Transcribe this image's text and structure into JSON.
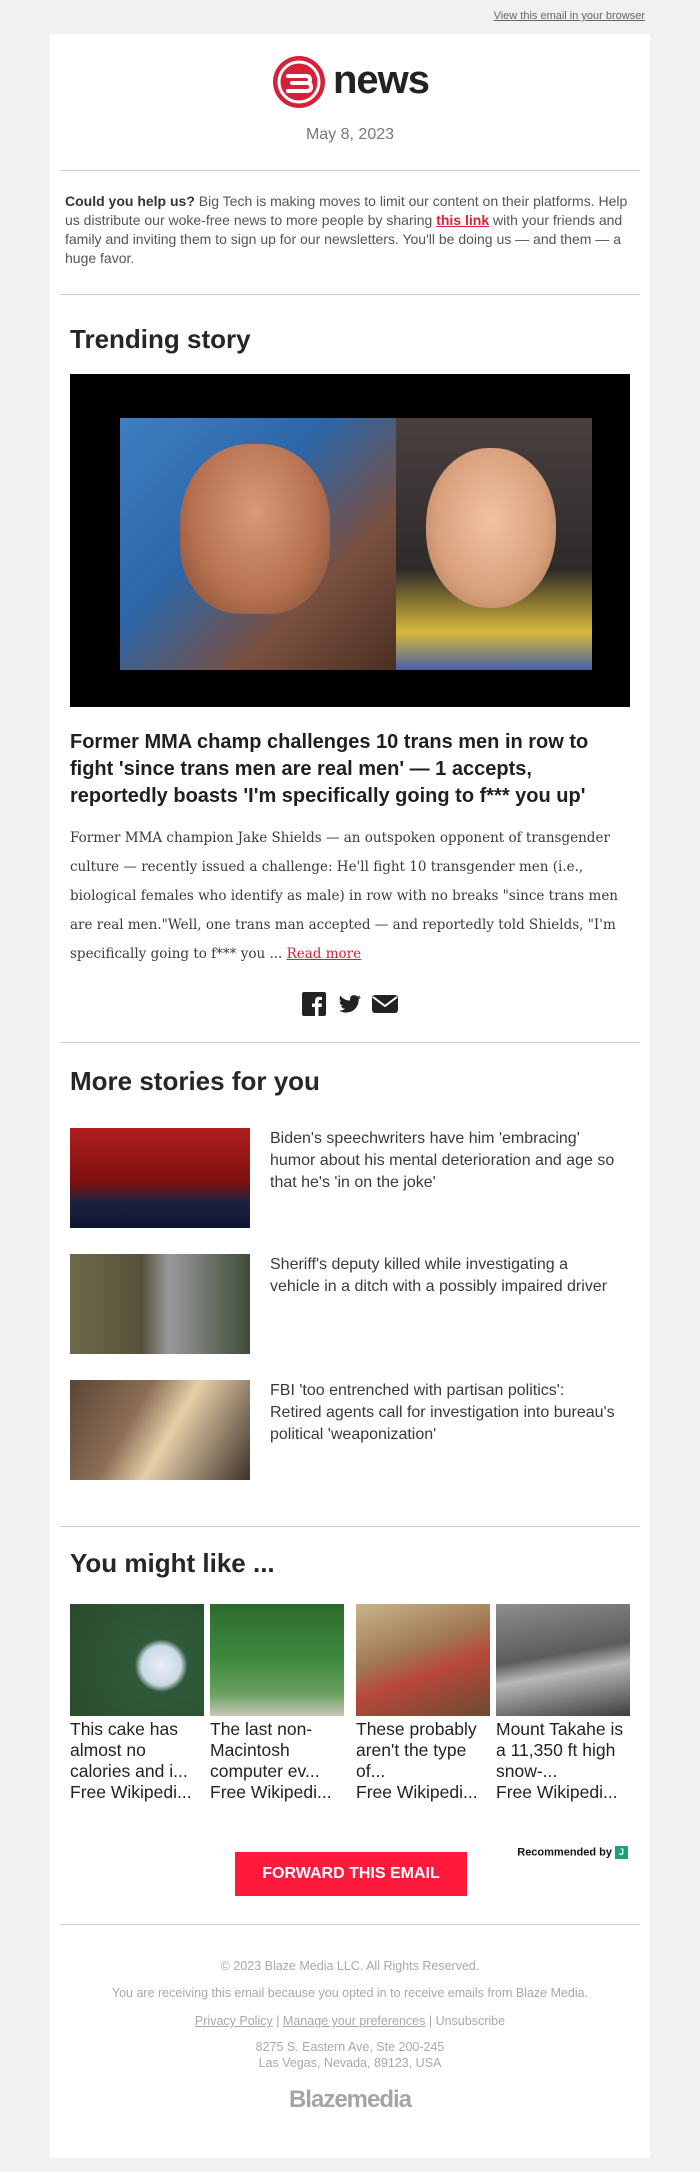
{
  "top": {
    "view_in_browser": "View this email in your browser"
  },
  "brand": {
    "logo_text": "news",
    "date": "May 8, 2023"
  },
  "help": {
    "lead": "Could you help us?",
    "text_before": " Big Tech is making moves to limit our content on their platforms. Help us distribute our woke-free news to more people by sharing ",
    "link": "this link",
    "text_after": " with your friends and family and inviting them to sign up for our newsletters. You'll be doing us — and them — a huge favor."
  },
  "trending": {
    "heading": "Trending story",
    "headline": "Former MMA champ challenges 10 trans men in row to fight 'since trans men are real men' — 1 accepts, reportedly boasts 'I'm specifically going to f*** you up'",
    "excerpt": "Former MMA champion Jake Shields — an outspoken opponent of transgender culture — recently issued a challenge: He'll fight 10 transgender men (i.e., biological females who identify as male) in row with no breaks \"since trans men are real men.\"Well, one trans man accepted — and reportedly told Shields, \"I'm specifically going to f*** you ... ",
    "read_more": "Read more"
  },
  "more": {
    "heading": "More stories for you",
    "stories": [
      {
        "title": "Biden's speechwriters have him 'embracing' humor about his mental deterioration and age so that he's 'in on the joke'"
      },
      {
        "title": "Sheriff's deputy killed while investigating a vehicle in a ditch with a possibly impaired driver"
      },
      {
        "title": "FBI 'too entrenched with partisan politics': Retired agents call for investigation into bureau's political 'weaponization'"
      }
    ]
  },
  "like": {
    "heading": "You might like ...",
    "items": [
      {
        "title": "This cake has almost no calories and i...",
        "source": "Free Wikipedi..."
      },
      {
        "title": "The last non-Macintosh computer ev...",
        "source": "Free Wikipedi..."
      },
      {
        "title": "These probably aren't the type of...",
        "source": "Free Wikipedi..."
      },
      {
        "title": "Mount Takahe is a 11,350 ft high snow-...",
        "source": "Free Wikipedi..."
      }
    ],
    "recommended_by": "Recommended by",
    "rec_badge": "J"
  },
  "forward": "FORWARD THIS EMAIL",
  "footer": {
    "copyright": "© 2023 Blaze Media LLC. All Rights Reserved.",
    "receiving": "You are receiving this email because you opted in to receive emails from Blaze Media.",
    "privacy": "Privacy Policy",
    "preferences": "Manage your preferences",
    "unsubscribe": "Unsubscribe",
    "address1": "8275 S. Eastern Ave, Ste 200-245",
    "address2": "Las Vegas, Nevada, 89123, USA",
    "brand": "Blazemedia"
  },
  "colors": {
    "accent": "#d5213a",
    "button": "#ff1a3c"
  }
}
